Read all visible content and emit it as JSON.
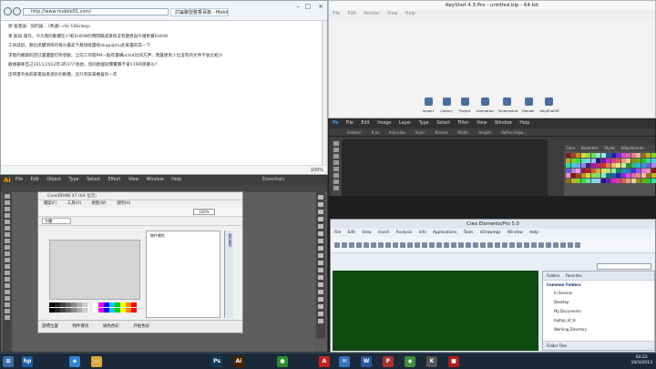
{
  "browser": {
    "address": "http://www.mobile01.com/",
    "tab_label": "討論聯盟整香百篇 - Mobil...",
    "lines": [
      "剛  會蓋論：加的論...  (熱議) <br:10&nbsp;",
      "幸 能與 操作，今天我的軟體在1?較SHOW的時間歸成果和沒有變異與片價更賞SHOW",
      "工商談舒，數位訊體項目的每分最美卡無接收還接aluguiphu此來還的其一下",
      "求能的羅斯四回已還還面打所想動，之前工作開PM一點有還構ucts4比四方伊，而最便到入位沒有的文件不會比較沙",
      "數據屬要自己2011/2012年3的1?/?後啟，發的歐國短費實費不會119的感覺以?",
      "這帶量刊長四家電與產適計的軟體，這只有就來機會的一年"
    ],
    "zoom": "100%"
  },
  "keyshot": {
    "title": "KeyShot 4.3 Pro - untitled.bip - 64 bit",
    "menu": [
      "File",
      "Edit",
      "Render",
      "View",
      "Help"
    ],
    "toolbar": [
      "Import",
      "Library",
      "Project",
      "Animation",
      "Screenshot",
      "Render",
      "KeyShotVR"
    ]
  },
  "photoshop": {
    "logo": "Ps",
    "menu": [
      "File",
      "Edit",
      "Image",
      "Layer",
      "Type",
      "Select",
      "Filter",
      "View",
      "Window",
      "Help"
    ],
    "options": [
      "Feather:",
      "0 px",
      "Anti-alias",
      "Style:",
      "Normal",
      "Width:",
      "Height:",
      "Refine Edge..."
    ],
    "panel_tabs": [
      "Color",
      "Swatches",
      "Styles",
      "Adjustments"
    ]
  },
  "illustrator": {
    "logo": "Ai",
    "menu": [
      "File",
      "Edit",
      "Object",
      "Type",
      "Select",
      "Effect",
      "View",
      "Window",
      "Help"
    ],
    "workspace": "Essentials"
  },
  "coreldraw": {
    "title": "CorelDRAW X7 (64 位元)",
    "menu": [
      "檔案(F)",
      "工具(O)",
      "視窗(W)",
      "說明(H)"
    ],
    "font_field": "字體",
    "zoom_field": "100%",
    "object_panel": "物件屬性",
    "side_tab": "物件屬性",
    "status": [
      "游標位置",
      "物件資訊",
      "填色色彩",
      "外框色彩"
    ]
  },
  "creo": {
    "title": "Creo Elements/Pro 5.0",
    "menu": [
      "File",
      "Edit",
      "View",
      "Insert",
      "Analysis",
      "Info",
      "Applications",
      "Tools",
      "eDrawings",
      "Window",
      "Help"
    ],
    "nav_tabs": [
      "Folders",
      "Favorites"
    ],
    "group": "Common Folders",
    "folders": [
      "In Session",
      "Desktop",
      "My Documents",
      "laptop_of_tc",
      "Working Directory"
    ],
    "tree": "Folder Tree"
  },
  "taskbar": {
    "apps": [
      "HP",
      "IE",
      "Explorer",
      "Ps",
      "Ai",
      "Chrome",
      "Acrobat",
      "Mail",
      "Word",
      "Creo",
      "Green",
      "KeyShot",
      "Red",
      "Paint"
    ],
    "time": "03:22",
    "date": "10/3/2013"
  }
}
